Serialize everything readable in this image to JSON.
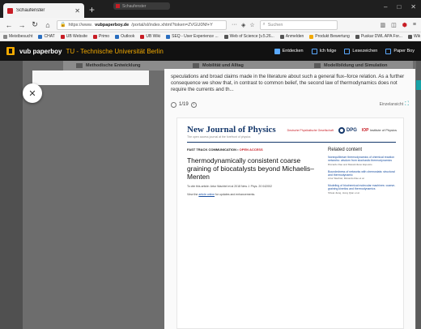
{
  "browser": {
    "tab_title": "Schaufenster",
    "tab2_title": "Schaufenster",
    "url_prefix": "https://www.",
    "url_domain": "vubpaperboy.de",
    "url_rest": "/portal/sl/index.xhtml?token=ZVGU0Nf+Y",
    "search_placeholder": "Suchen",
    "bookmarks": [
      {
        "label": "Meistbesucht",
        "color": "#888888"
      },
      {
        "label": "CHAT",
        "color": "#2a6ebf"
      },
      {
        "label": "UB Website",
        "color": "#c81d25"
      },
      {
        "label": "Primo",
        "color": "#c81d25"
      },
      {
        "label": "Outlook",
        "color": "#2a6ebf"
      },
      {
        "label": "UB Wiki",
        "color": "#c81d25"
      },
      {
        "label": "SEQ - User Experience ...",
        "color": "#2a6ebf"
      },
      {
        "label": "Web of Science [v.5.26...",
        "color": "#555555"
      },
      {
        "label": "Anmelden",
        "color": "#555555"
      },
      {
        "label": "Produkt Bewertung",
        "color": "#f2a900"
      },
      {
        "label": "Puskar DWL APA For...",
        "color": "#555555"
      },
      {
        "label": "Wik",
        "color": "#555555"
      }
    ]
  },
  "app": {
    "brand": "vub paperboy",
    "institution": "TU - Technische Universität Berlin",
    "nav": [
      {
        "label": "Entdecken",
        "icon": "compass-icon"
      },
      {
        "label": "Ich folge",
        "icon": "star-icon"
      },
      {
        "label": "Lesezeichen",
        "icon": "bookmark-icon"
      },
      {
        "label": "Paper Boy",
        "icon": "user-icon"
      }
    ]
  },
  "background_categories": [
    {
      "label": "Methodische Entwicklung"
    },
    {
      "label": "Mobilität und Alltag"
    },
    {
      "label": "Modellbildung und Simulation"
    }
  ],
  "modal": {
    "abstract": "speculations and broad claims made in the literature about such a general flux–force relation. As a further consequence we show that, in contrast to common belief, the second law of thermodynamics does not require the currents and th...",
    "page_indicator": "1/19",
    "embed_label": "Einzelansicht"
  },
  "pdf": {
    "journal": "New Journal of Physics",
    "journal_sub": "The open access journal at the forefront of physics",
    "publisher_dpg_text": "Deutsche Physikalische Gesellschaft",
    "dpg": "DPG",
    "iop_b": "IOP",
    "iop": "Institute of Physics",
    "ftc_prefix": "FAST TRACK COMMUNICATION •",
    "ftc_oa": "OPEN ACCESS",
    "title": "Thermodynamically consistent coarse graining of biocatalysts beyond Michaelis–Menten",
    "cite": "To cite this article: Artur Wachtel et al 2018 New J. Phys. 20 042002",
    "view_prefix": "View the",
    "view_link": "article online",
    "view_suffix": "for updates and enhancements.",
    "related_heading": "Related content",
    "related": [
      {
        "title": "Nonequilibrium thermodynamics of chemical reaction networks: wisdom from stochastic thermodynamics",
        "authors": "Riccardo Rao and Massimiliano Esposito"
      },
      {
        "title": "Boundedness of networks with chemostats: structural and thermodynamic",
        "authors": "Artur Wachtel, Riccardo Rao et al."
      },
      {
        "title": "Modeling of biochemical molecular machines: coarse-graining kinetics and thermodynamics",
        "authors": "Shwai Jiang, Hong Qian et al."
      }
    ]
  }
}
